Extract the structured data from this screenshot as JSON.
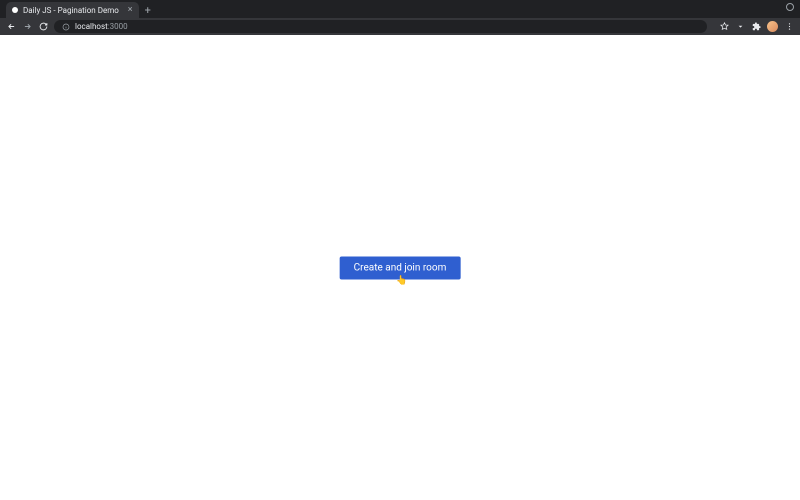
{
  "browser": {
    "tab": {
      "title": "Daily JS - Pagination Demo"
    },
    "url": {
      "host": "localhost",
      "port": ":3000"
    }
  },
  "page": {
    "primary_button_label": "Create and join room"
  },
  "colors": {
    "accent": "#2f5fd0"
  }
}
